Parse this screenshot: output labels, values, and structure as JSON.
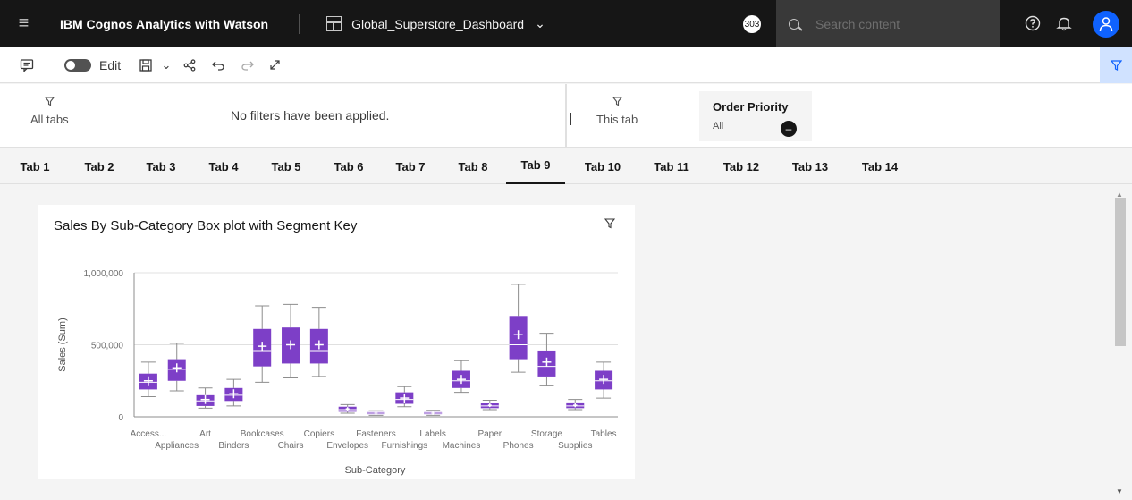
{
  "topbar": {
    "product": "IBM Cognos Analytics with Watson",
    "dashboard_title": "Global_Superstore_Dashboard",
    "notification_count": "303",
    "search_placeholder": "Search content"
  },
  "toolbar": {
    "edit_label": "Edit"
  },
  "filters": {
    "all_tabs_label": "All tabs",
    "no_filters_text": "No filters have been applied.",
    "this_tab_label": "This tab",
    "order_priority": {
      "title": "Order Priority",
      "value": "All"
    }
  },
  "tabs": [
    "Tab 1",
    "Tab 2",
    "Tab 3",
    "Tab 4",
    "Tab 5",
    "Tab 6",
    "Tab 7",
    "Tab 8",
    "Tab 9",
    "Tab 10",
    "Tab 11",
    "Tab 12",
    "Tab 13",
    "Tab 14"
  ],
  "active_tab": "Tab 9",
  "colors": {
    "box_fill": "#7d3fc7",
    "topbar": "#161616",
    "accent": "#0f62fe"
  },
  "chart_data": {
    "type": "boxplot",
    "title": "Sales By Sub-Category Box plot with Segment Key",
    "xlabel": "Sub-Category",
    "ylabel": "Sales (Sum)",
    "ylim": [
      0,
      1000000
    ],
    "yticks": [
      "1,000,000",
      "500,000",
      "0"
    ],
    "ytick_values": [
      1000000,
      500000,
      0
    ],
    "grid": true,
    "categories": [
      "Access...",
      "Appliances",
      "Art",
      "Binders",
      "Bookcases",
      "Chairs",
      "Copiers",
      "Envelopes",
      "Fasteners",
      "Furnishings",
      "Labels",
      "Machines",
      "Paper",
      "Phones",
      "Storage",
      "Supplies",
      "Tables"
    ],
    "boxes": [
      {
        "category": "Access...",
        "min": 140000,
        "q1": 190000,
        "median": 240000,
        "q3": 300000,
        "max": 380000,
        "mean": 250000
      },
      {
        "category": "Appliances",
        "min": 180000,
        "q1": 250000,
        "median": 330000,
        "q3": 400000,
        "max": 510000,
        "mean": 340000
      },
      {
        "category": "Art",
        "min": 60000,
        "q1": 75000,
        "median": 110000,
        "q3": 150000,
        "max": 200000,
        "mean": 120000
      },
      {
        "category": "Binders",
        "min": 75000,
        "q1": 110000,
        "median": 150000,
        "q3": 200000,
        "max": 260000,
        "mean": 160000
      },
      {
        "category": "Bookcases",
        "min": 240000,
        "q1": 350000,
        "median": 460000,
        "q3": 610000,
        "max": 770000,
        "mean": 490000
      },
      {
        "category": "Chairs",
        "min": 270000,
        "q1": 370000,
        "median": 450000,
        "q3": 620000,
        "max": 780000,
        "mean": 500000
      },
      {
        "category": "Copiers",
        "min": 280000,
        "q1": 370000,
        "median": 460000,
        "q3": 610000,
        "max": 760000,
        "mean": 500000
      },
      {
        "category": "Envelopes",
        "min": 25000,
        "q1": 35000,
        "median": 50000,
        "q3": 70000,
        "max": 85000,
        "mean": 55000
      },
      {
        "category": "Fasteners",
        "min": 10000,
        "q1": 18000,
        "median": 25000,
        "q3": 32000,
        "max": 42000,
        "mean": 25000
      },
      {
        "category": "Furnishings",
        "min": 70000,
        "q1": 90000,
        "median": 120000,
        "q3": 170000,
        "max": 210000,
        "mean": 130000
      },
      {
        "category": "Labels",
        "min": 10000,
        "q1": 18000,
        "median": 25000,
        "q3": 32000,
        "max": 45000,
        "mean": 25000
      },
      {
        "category": "Machines",
        "min": 170000,
        "q1": 200000,
        "median": 250000,
        "q3": 320000,
        "max": 390000,
        "mean": 260000
      },
      {
        "category": "Paper",
        "min": 50000,
        "q1": 60000,
        "median": 75000,
        "q3": 95000,
        "max": 115000,
        "mean": 80000
      },
      {
        "category": "Phones",
        "min": 310000,
        "q1": 400000,
        "median": 500000,
        "q3": 700000,
        "max": 920000,
        "mean": 570000
      },
      {
        "category": "Storage",
        "min": 220000,
        "q1": 280000,
        "median": 350000,
        "q3": 460000,
        "max": 580000,
        "mean": 380000
      },
      {
        "category": "Supplies",
        "min": 50000,
        "q1": 60000,
        "median": 75000,
        "q3": 100000,
        "max": 120000,
        "mean": 80000
      },
      {
        "category": "Tables",
        "min": 130000,
        "q1": 190000,
        "median": 250000,
        "q3": 320000,
        "max": 380000,
        "mean": 260000
      }
    ]
  }
}
